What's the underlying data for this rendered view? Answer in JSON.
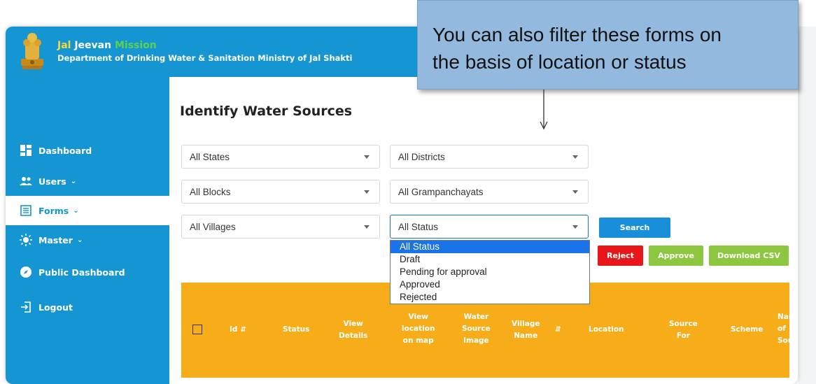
{
  "header": {
    "brand_word1": "Jal",
    "brand_word2": " Jeevan",
    "brand_word3": " Mission",
    "department": "Department of Drinking Water & Sanitation Ministry of Jal Shakti"
  },
  "sidebar": {
    "items": [
      {
        "label": "Dashboard",
        "icon": "dashboard-icon"
      },
      {
        "label": "Users",
        "icon": "users-icon"
      },
      {
        "label": "Forms",
        "icon": "forms-icon"
      },
      {
        "label": "Master",
        "icon": "master-icon"
      },
      {
        "label": "Public Dashboard",
        "icon": "compass-icon"
      },
      {
        "label": "Logout",
        "icon": "logout-icon"
      }
    ]
  },
  "page": {
    "title": "Identify Water Sources"
  },
  "filters": {
    "states": "All States",
    "districts": "All Districts",
    "blocks": "All Blocks",
    "grampanchayats": "All Grampanchayats",
    "villages": "All Villages",
    "status": "All Status"
  },
  "buttons": {
    "search": "Search",
    "reject": "Reject",
    "approve": "Approve",
    "download_csv": "Download CSV"
  },
  "status_dropdown": {
    "options": [
      "All Status",
      "Draft",
      "Pending for approval",
      "Approved",
      "Rejected"
    ],
    "selected": "All Status"
  },
  "table": {
    "headers": {
      "id": "Id",
      "status": "Status",
      "view_details_1": "View",
      "view_details_2": "Details",
      "view_loc_1": "View",
      "view_loc_2": "location",
      "view_loc_3": "on map",
      "water_img_1": "Water",
      "water_img_2": "Source",
      "water_img_3": "Image",
      "village_1": "Village",
      "village_2": "Name",
      "location": "Location",
      "source_for_1": "Source",
      "source_for_2": "For",
      "scheme": "Scheme",
      "name_src_1": "Nar",
      "name_src_2": "of",
      "name_src_3": "Sou"
    }
  },
  "callout": {
    "line1": "You can also filter these forms on",
    "line2": "the basis of location or status"
  },
  "colors": {
    "primary": "#1596d3",
    "table_header": "#f7ad19",
    "reject": "#e8161b",
    "approve": "#8dc63f",
    "callout": "#94b9de"
  }
}
